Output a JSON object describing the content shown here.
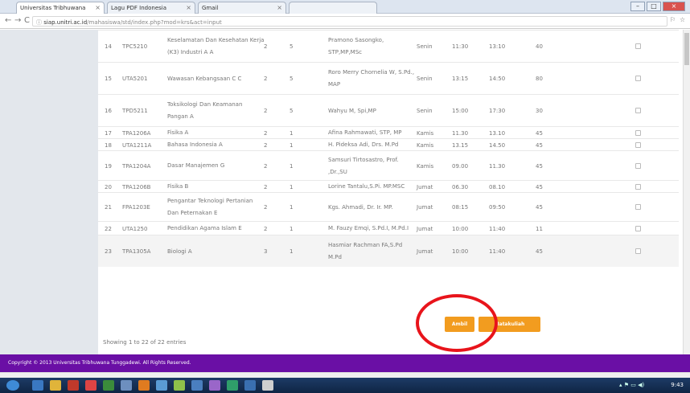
{
  "browser": {
    "tabs": [
      {
        "title": "Universitas Tribhuwana",
        "active": true
      },
      {
        "title": "Lagu PDF Indonesia",
        "active": false
      },
      {
        "title": "Gmail",
        "active": false
      },
      {
        "title": "",
        "active": false
      }
    ],
    "url_host": "siap.unitri.ac.id",
    "url_path": "/mahasiswa/std/index.php?mod=krs&act=input"
  },
  "table": {
    "rows": [
      {
        "no": "14",
        "code": "TPC5210",
        "name": [
          "Keselamatan Dan Kesehatan Kerja",
          "(K3) Industri A A"
        ],
        "sks": "2",
        "sem": "5",
        "lecturer": [
          "Pramono Sasongko,",
          "STP,MP,MSc"
        ],
        "day": "Senin",
        "start": "11:30",
        "end": "13:10",
        "quota": "40"
      },
      {
        "no": "15",
        "code": "UTA5201",
        "name": [
          "Wawasan Kebangsaan C C"
        ],
        "sks": "2",
        "sem": "5",
        "lecturer": [
          "Roro Merry Chornelia W, S.Pd.,",
          "MAP"
        ],
        "day": "Senin",
        "start": "13:15",
        "end": "14:50",
        "quota": "80"
      },
      {
        "no": "16",
        "code": "TPD5211",
        "name": [
          "Toksikologi Dan Keamanan",
          "Pangan A"
        ],
        "sks": "2",
        "sem": "5",
        "lecturer": [
          "Wahyu M, Spi,MP"
        ],
        "day": "Senin",
        "start": "15:00",
        "end": "17:30",
        "quota": "30"
      },
      {
        "no": "17",
        "code": "TPA1206A",
        "name": [
          "Fisika A"
        ],
        "sks": "2",
        "sem": "1",
        "lecturer": [
          "Afina Rahmawati, STP, MP"
        ],
        "day": "Kamis",
        "start": "11.30",
        "end": "13.10",
        "quota": "45"
      },
      {
        "no": "18",
        "code": "UTA1211A",
        "name": [
          "Bahasa Indonesia A"
        ],
        "sks": "2",
        "sem": "1",
        "lecturer": [
          "H. Pideksa Adi, Drs. M.Pd"
        ],
        "day": "Kamis",
        "start": "13.15",
        "end": "14.50",
        "quota": "45"
      },
      {
        "no": "19",
        "code": "TPA1204A",
        "name": [
          "Dasar Manajemen G"
        ],
        "sks": "2",
        "sem": "1",
        "lecturer": [
          "Samsuri Tirtosastro, Prof.",
          ",Dr.,SU"
        ],
        "day": "Kamis",
        "start": "09.00",
        "end": "11.30",
        "quota": "45"
      },
      {
        "no": "20",
        "code": "TPA1206B",
        "name": [
          "Fisika B"
        ],
        "sks": "2",
        "sem": "1",
        "lecturer": [
          "Lorine Tantalu,S.Pi. MP.MSC"
        ],
        "day": "Jumat",
        "start": "06.30",
        "end": "08.10",
        "quota": "45"
      },
      {
        "no": "21",
        "code": "FPA1203E",
        "name": [
          "Pengantar Teknologi Pertanian",
          "Dan Peternakan E"
        ],
        "sks": "2",
        "sem": "1",
        "lecturer": [
          "Kgs. Ahmadi, Dr. Ir. MP."
        ],
        "day": "Jumat",
        "start": "08:15",
        "end": "09:50",
        "quota": "45"
      },
      {
        "no": "22",
        "code": "UTA1250",
        "name": [
          "Pendidikan Agama Islam E"
        ],
        "sks": "2",
        "sem": "1",
        "lecturer": [
          "M. Fauzy Emqi, S.Pd.I, M.Pd.I"
        ],
        "day": "Jumat",
        "start": "10:00",
        "end": "11:40",
        "quota": "11"
      },
      {
        "no": "23",
        "code": "TPA1305A",
        "name": [
          "Biologi A"
        ],
        "sks": "3",
        "sem": "1",
        "lecturer": [
          "Hasmiar Rachman FA,S.Pd",
          "M.Pd"
        ],
        "day": "Jumat",
        "start": "10:00",
        "end": "11:40",
        "quota": "45"
      }
    ]
  },
  "info_text": "Showing 1 to 22 of 22 entries",
  "buttons": {
    "ambil": "Ambil",
    "second": "Matakuliah"
  },
  "footer_text": "Copyright © 2013 Universitas Tribhuwana Tunggadewi. All Rights Reserved.",
  "clock": "9:43",
  "colors": {
    "accent": "#f29c1f",
    "footer": "#6a0fa5",
    "highlight": "#e8141b"
  }
}
